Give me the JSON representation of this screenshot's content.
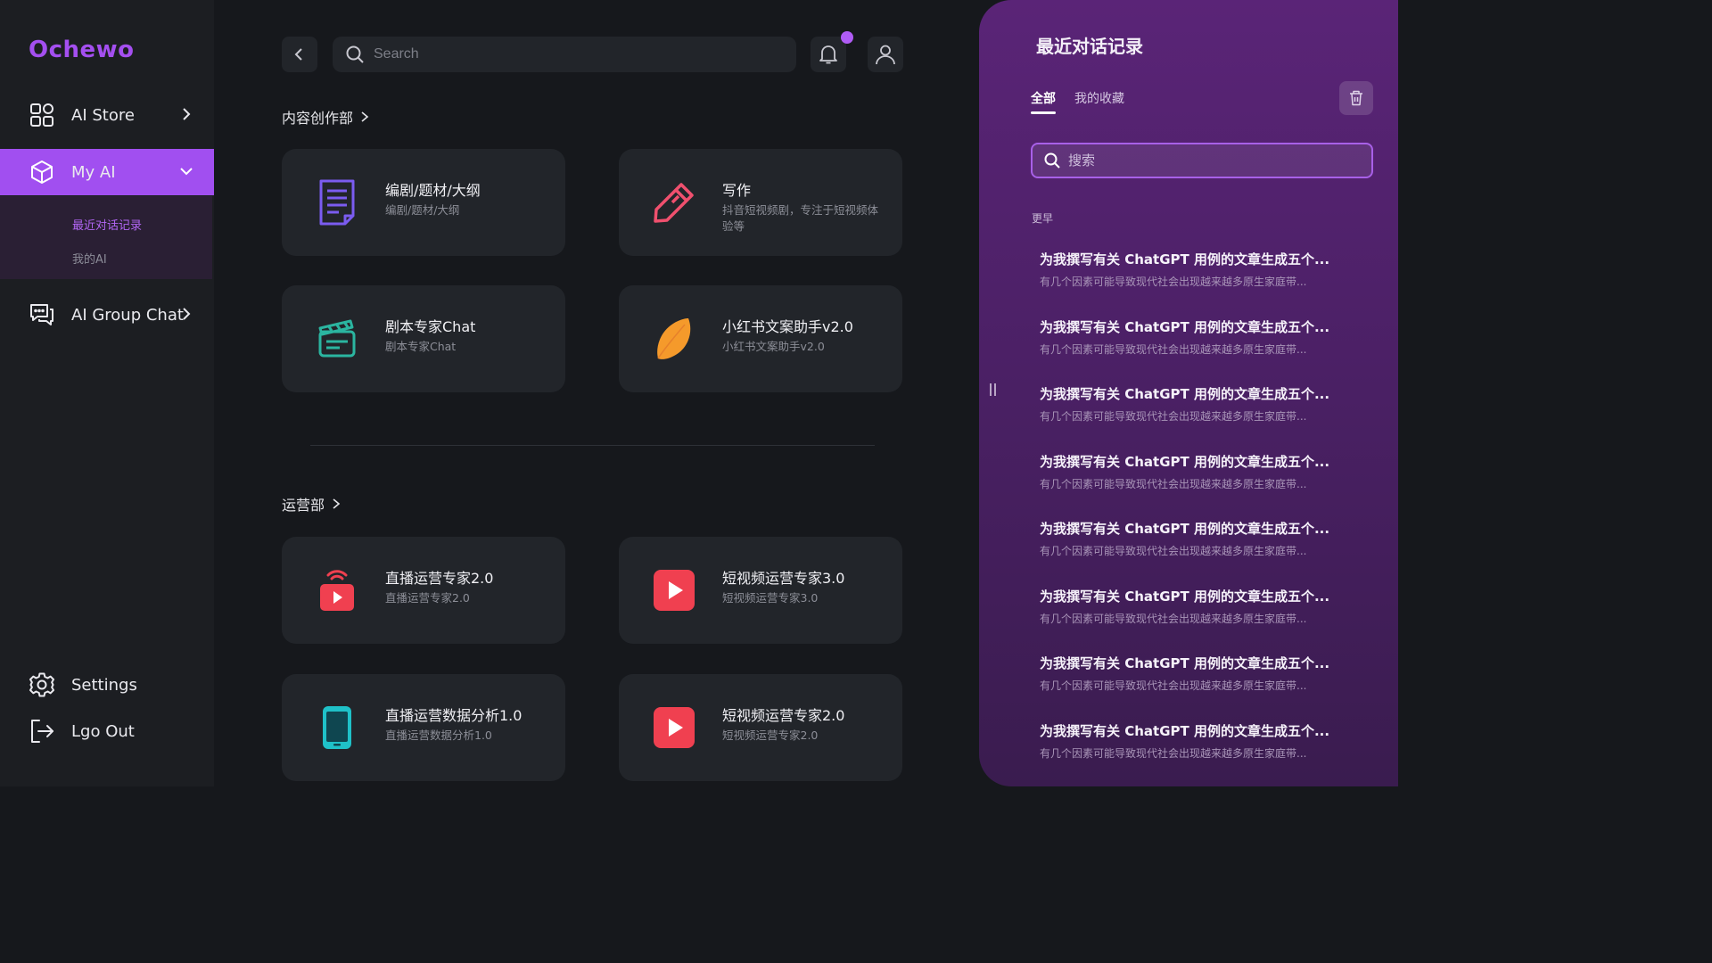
{
  "app": {
    "logo_text": "Ochewo"
  },
  "sidebar": {
    "items": [
      {
        "label": "AI Store",
        "icon": "grid-icon"
      },
      {
        "label": "My AI",
        "icon": "cube-icon"
      },
      {
        "label": "AI Group Chat",
        "icon": "chat-bubbles-icon"
      }
    ],
    "sub_items": [
      {
        "label": "最近对话记录"
      },
      {
        "label": "我的AI"
      }
    ],
    "bottom": [
      {
        "label": "Settings",
        "icon": "gear-icon"
      },
      {
        "label": "Lgo Out",
        "icon": "logout-icon"
      }
    ]
  },
  "header": {
    "search_placeholder": "Search",
    "notification_dot_color": "#b05cf5"
  },
  "sections": [
    {
      "title": "内容创作部",
      "cards": [
        {
          "title": "编剧/题材/大纲",
          "subtitle": "编剧/题材/大纲",
          "icon": "document-icon",
          "color": "#7b5cf0"
        },
        {
          "title": "写作",
          "subtitle": "抖音短视频剧，专注于短视频体验等",
          "icon": "pencil-icon",
          "color": "#f0506e"
        },
        {
          "title": "剧本专家Chat",
          "subtitle": "剧本专家Chat",
          "icon": "clapperboard-icon",
          "color": "#2bb5a0"
        },
        {
          "title": "小红书文案助手v2.0",
          "subtitle": "小红书文案助手v2.0",
          "icon": "leaf-icon",
          "color": "#f59a2b"
        }
      ]
    },
    {
      "title": "运营部",
      "cards": [
        {
          "title": "直播运营专家2.0",
          "subtitle": "直播运营专家2.0",
          "icon": "live-tv-icon",
          "color": "#f04050"
        },
        {
          "title": "短视频运营专家3.0",
          "subtitle": "短视频运营专家3.0",
          "icon": "play-icon",
          "color": "#f04050"
        },
        {
          "title": "直播运营数据分析1.0",
          "subtitle": "直播运营数据分析1.0",
          "icon": "phone-icon",
          "color": "#1fc1c8"
        },
        {
          "title": "短视频运营专家2.0",
          "subtitle": "短视频运营专家2.0",
          "icon": "play-icon",
          "color": "#f04050"
        }
      ]
    }
  ],
  "right_panel": {
    "title": "最近对话记录",
    "tabs": [
      {
        "label": "全部",
        "active": true
      },
      {
        "label": "我的收藏",
        "active": false
      }
    ],
    "search_placeholder": "搜索",
    "group_label": "更早",
    "history": [
      {
        "title": "为我撰写有关 ChatGPT 用例的文章生成五个...",
        "snippet": "有几个因素可能导致现代社会出现越来越多原生家庭带..."
      },
      {
        "title": "为我撰写有关 ChatGPT 用例的文章生成五个...",
        "snippet": "有几个因素可能导致现代社会出现越来越多原生家庭带..."
      },
      {
        "title": "为我撰写有关 ChatGPT 用例的文章生成五个...",
        "snippet": "有几个因素可能导致现代社会出现越来越多原生家庭带..."
      },
      {
        "title": "为我撰写有关 ChatGPT 用例的文章生成五个...",
        "snippet": "有几个因素可能导致现代社会出现越来越多原生家庭带..."
      },
      {
        "title": "为我撰写有关 ChatGPT 用例的文章生成五个...",
        "snippet": "有几个因素可能导致现代社会出现越来越多原生家庭带..."
      },
      {
        "title": "为我撰写有关 ChatGPT 用例的文章生成五个...",
        "snippet": "有几个因素可能导致现代社会出现越来越多原生家庭带..."
      },
      {
        "title": "为我撰写有关 ChatGPT 用例的文章生成五个...",
        "snippet": "有几个因素可能导致现代社会出现越来越多原生家庭带..."
      },
      {
        "title": "为我撰写有关 ChatGPT 用例的文章生成五个...",
        "snippet": "有几个因素可能导致现代社会出现越来越多原生家庭带..."
      }
    ]
  }
}
